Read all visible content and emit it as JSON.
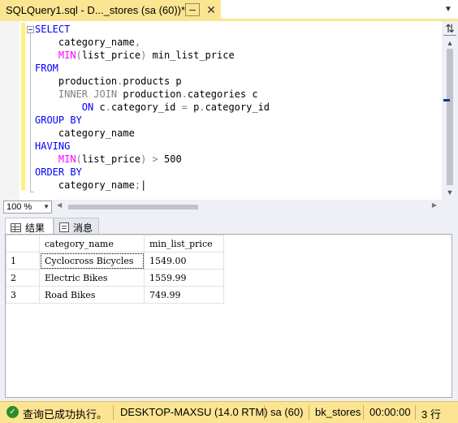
{
  "tab": {
    "title": "SQLQuery1.sql - D..._stores (sa (60))*",
    "close_glyph": "✕"
  },
  "editor": {
    "lines": [
      {
        "parts": [
          {
            "t": "SELECT",
            "c": "kw"
          }
        ]
      },
      {
        "parts": [
          {
            "t": "    category_name",
            "c": "txt"
          },
          {
            "t": ",",
            "c": "gray"
          }
        ]
      },
      {
        "parts": [
          {
            "t": "    ",
            "c": "txt"
          },
          {
            "t": "MIN",
            "c": "fn"
          },
          {
            "t": "(",
            "c": "gray"
          },
          {
            "t": "list_price",
            "c": "txt"
          },
          {
            "t": ")",
            "c": "gray"
          },
          {
            "t": " min_list_price",
            "c": "txt"
          }
        ]
      },
      {
        "parts": [
          {
            "t": "FROM",
            "c": "kw"
          }
        ]
      },
      {
        "parts": [
          {
            "t": "    production",
            "c": "txt"
          },
          {
            "t": ".",
            "c": "gray"
          },
          {
            "t": "products p",
            "c": "txt"
          }
        ]
      },
      {
        "parts": [
          {
            "t": "    ",
            "c": "txt"
          },
          {
            "t": "INNER JOIN",
            "c": "gray"
          },
          {
            "t": " production",
            "c": "txt"
          },
          {
            "t": ".",
            "c": "gray"
          },
          {
            "t": "categories c",
            "c": "txt"
          }
        ]
      },
      {
        "parts": [
          {
            "t": "        ",
            "c": "txt"
          },
          {
            "t": "ON",
            "c": "kw"
          },
          {
            "t": " c",
            "c": "txt"
          },
          {
            "t": ".",
            "c": "gray"
          },
          {
            "t": "category_id ",
            "c": "txt"
          },
          {
            "t": "=",
            "c": "gray"
          },
          {
            "t": " p",
            "c": "txt"
          },
          {
            "t": ".",
            "c": "gray"
          },
          {
            "t": "category_id",
            "c": "txt"
          }
        ]
      },
      {
        "parts": [
          {
            "t": "GROUP BY",
            "c": "kw"
          }
        ]
      },
      {
        "parts": [
          {
            "t": "    category_name",
            "c": "txt"
          }
        ]
      },
      {
        "parts": [
          {
            "t": "HAVING",
            "c": "kw"
          }
        ]
      },
      {
        "parts": [
          {
            "t": "    ",
            "c": "txt"
          },
          {
            "t": "MIN",
            "c": "fn"
          },
          {
            "t": "(",
            "c": "gray"
          },
          {
            "t": "list_price",
            "c": "txt"
          },
          {
            "t": ")",
            "c": "gray"
          },
          {
            "t": " ",
            "c": "txt"
          },
          {
            "t": ">",
            "c": "gray"
          },
          {
            "t": " 500",
            "c": "txt"
          }
        ]
      },
      {
        "parts": [
          {
            "t": "ORDER BY",
            "c": "kw"
          }
        ]
      },
      {
        "parts": [
          {
            "t": "    category_name",
            "c": "txt"
          },
          {
            "t": ";",
            "c": "gray"
          },
          {
            "t": "|",
            "c": "txt"
          }
        ]
      }
    ]
  },
  "zoom": {
    "value": "100 %"
  },
  "result_tabs": [
    {
      "label": "结果",
      "icon": "grid-icon"
    },
    {
      "label": "消息",
      "icon": "message-icon"
    }
  ],
  "results": {
    "columns": [
      "category_name",
      "min_list_price"
    ],
    "rows": [
      {
        "num": "1",
        "category_name": "Cyclocross Bicycles",
        "min_list_price": "1549.00"
      },
      {
        "num": "2",
        "category_name": "Electric Bikes",
        "min_list_price": "1559.99"
      },
      {
        "num": "3",
        "category_name": "Road Bikes",
        "min_list_price": "749.99"
      }
    ]
  },
  "status": {
    "message": "查询已成功执行。",
    "server": "DESKTOP-MAXSU (14.0 RTM)",
    "user": "sa (60)",
    "database": "bk_stores",
    "elapsed": "00:00:00",
    "rows": "3 行"
  },
  "colors": {
    "tab_accent": "#fbe592",
    "keyword": "#0000ff",
    "function": "#ff00ff",
    "operator": "#808080",
    "status_ok": "#2e8b2e"
  }
}
